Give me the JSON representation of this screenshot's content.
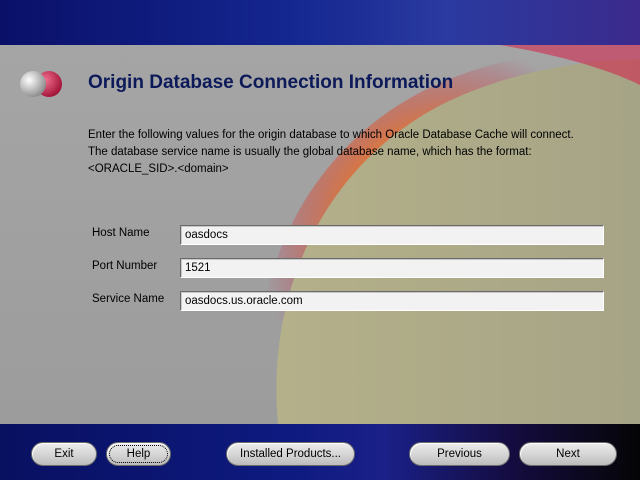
{
  "page": {
    "title": "Origin Database Connection Information",
    "intro_lines": [
      "Enter the following values for the origin database to which Oracle Database Cache will connect.",
      "The database service name is usually the global database name, which has the format:",
      "<ORACLE_SID>.<domain>"
    ]
  },
  "form": {
    "fields": [
      {
        "label": "Host Name",
        "value": "oasdocs"
      },
      {
        "label": "Port Number",
        "value": "1521"
      },
      {
        "label": "Service Name",
        "value": "oasdocs.us.oracle.com"
      }
    ]
  },
  "buttons": {
    "exit": "Exit",
    "help": "Help",
    "installed_products": "Installed Products...",
    "previous": "Previous",
    "next": "Next"
  },
  "colors": {
    "title": "#0c1a5a",
    "band_blue": "#142690",
    "sweep_olive": "#a8a88c",
    "glow_orange": "#ff9a2a",
    "glow_red": "#c01850"
  },
  "icons": {
    "logo": "oracle-spheres-logo"
  }
}
